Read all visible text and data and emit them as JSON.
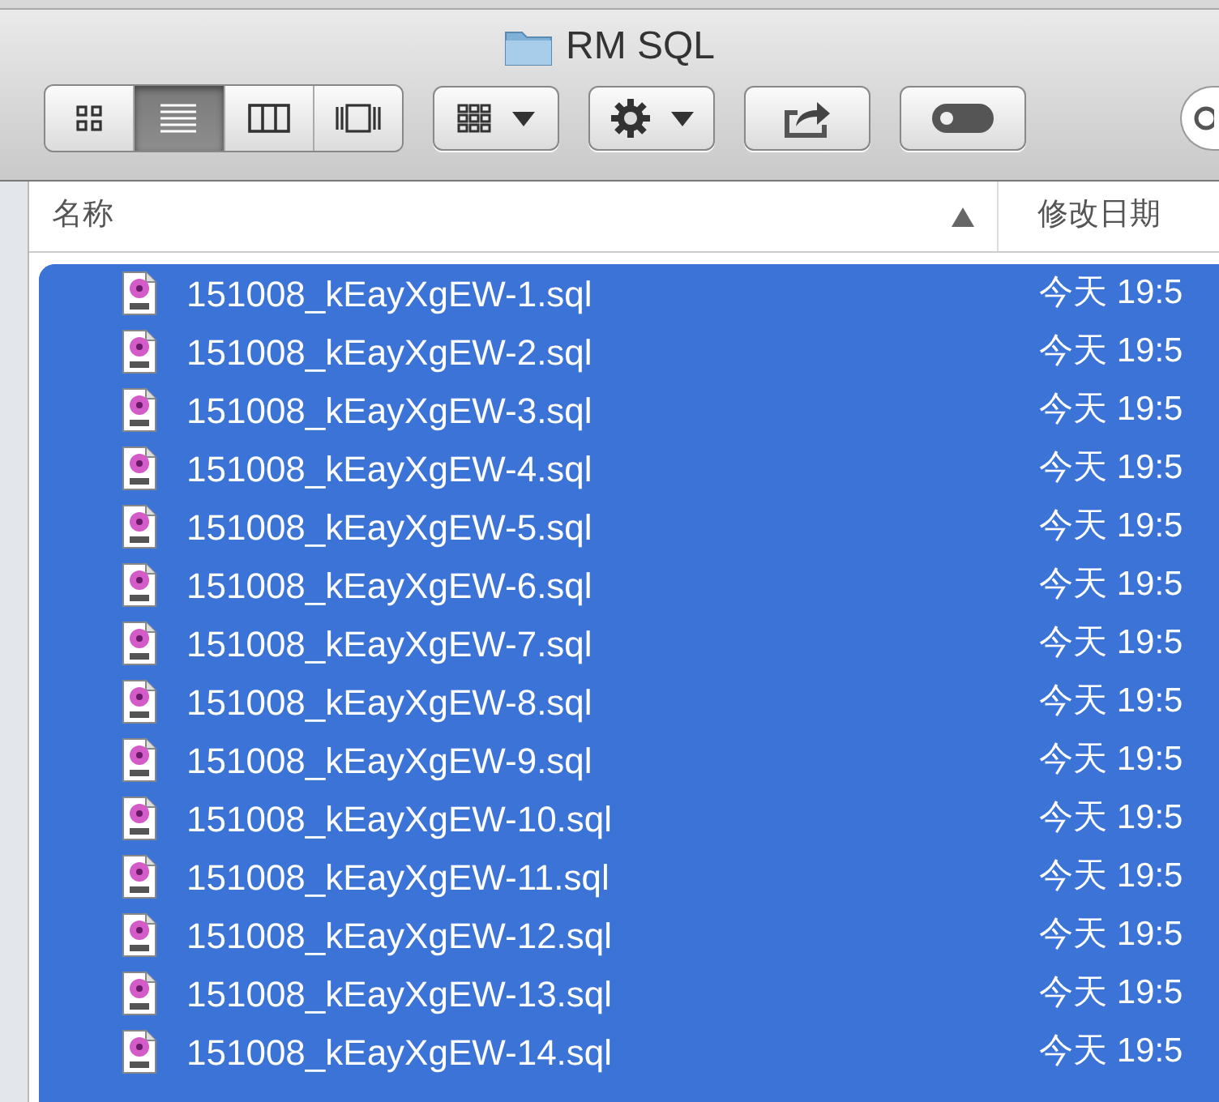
{
  "window": {
    "title": "RM SQL"
  },
  "toolbar": {
    "view_buttons": [
      {
        "kind": "icons",
        "selected": false
      },
      {
        "kind": "list",
        "selected": true
      },
      {
        "kind": "columns",
        "selected": false
      },
      {
        "kind": "coverflow",
        "selected": false
      }
    ]
  },
  "table": {
    "columns": [
      {
        "label": "名称",
        "sorted": true
      },
      {
        "label": "修改日期",
        "sorted": false
      }
    ],
    "rows": [
      {
        "name": "151008_kEayXgEW-1.sql",
        "date": "今天 19:5",
        "selected": true
      },
      {
        "name": "151008_kEayXgEW-2.sql",
        "date": "今天 19:5",
        "selected": true
      },
      {
        "name": "151008_kEayXgEW-3.sql",
        "date": "今天 19:5",
        "selected": true
      },
      {
        "name": "151008_kEayXgEW-4.sql",
        "date": "今天 19:5",
        "selected": true
      },
      {
        "name": "151008_kEayXgEW-5.sql",
        "date": "今天 19:5",
        "selected": true
      },
      {
        "name": "151008_kEayXgEW-6.sql",
        "date": "今天 19:5",
        "selected": true
      },
      {
        "name": "151008_kEayXgEW-7.sql",
        "date": "今天 19:5",
        "selected": true
      },
      {
        "name": "151008_kEayXgEW-8.sql",
        "date": "今天 19:5",
        "selected": true
      },
      {
        "name": "151008_kEayXgEW-9.sql",
        "date": "今天 19:5",
        "selected": true
      },
      {
        "name": "151008_kEayXgEW-10.sql",
        "date": "今天 19:5",
        "selected": true
      },
      {
        "name": "151008_kEayXgEW-11.sql",
        "date": "今天 19:5",
        "selected": true
      },
      {
        "name": "151008_kEayXgEW-12.sql",
        "date": "今天 19:5",
        "selected": true
      },
      {
        "name": "151008_kEayXgEW-13.sql",
        "date": "今天 19:5",
        "selected": true
      },
      {
        "name": "151008_kEayXgEW-14.sql",
        "date": "今天 19:5",
        "selected": true
      }
    ]
  }
}
